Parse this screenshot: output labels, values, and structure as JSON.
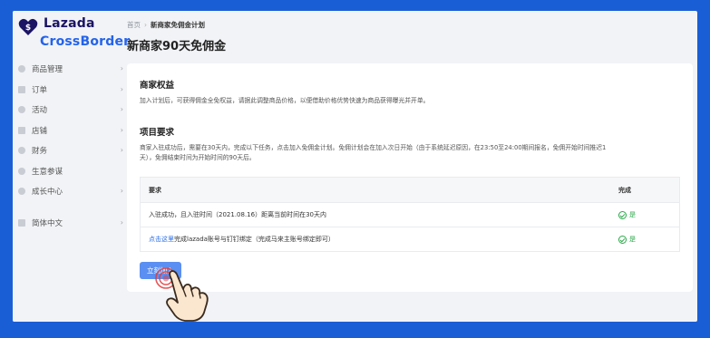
{
  "logo": {
    "line1": "Lazada",
    "line2": "CrossBorder"
  },
  "sidebar": {
    "items": [
      {
        "label": "商品管理",
        "icon": "box-icon"
      },
      {
        "label": "订单",
        "icon": "order-icon"
      },
      {
        "label": "活动",
        "icon": "activity-icon"
      },
      {
        "label": "店铺",
        "icon": "store-icon"
      },
      {
        "label": "财务",
        "icon": "finance-icon"
      },
      {
        "label": "生意参谋",
        "icon": "insight-icon"
      },
      {
        "label": "成长中心",
        "icon": "growth-icon"
      }
    ],
    "language": {
      "label": "简体中文",
      "icon": "language-icon"
    }
  },
  "breadcrumb": {
    "home": "首页",
    "current": "新商家免佣金计划"
  },
  "page_title": "新商家90天免佣金",
  "benefit": {
    "title": "商家权益",
    "text": "加入计划后，可获得佣金全免权益，请据此调整商品价格，以便借助价格优势快速为商品获得曝光并开单。"
  },
  "requirements": {
    "title": "项目要求",
    "text_line1": "商家入驻成功后，需要在30天内，完成以下任务，点击加入免佣金计划。免佣计划会在加入次日开始（由于系统延迟原因，在23:50至24:00期间报名，免佣开始时间推迟1",
    "text_line2": "天），免佣结束时间为开始时间的90天后。",
    "table": {
      "col_requirement": "要求",
      "col_done": "完成",
      "rows": [
        {
          "prefix": "",
          "link": "",
          "text": "入驻成功，且入驻时间（2021.08.16）距离当前时间在30天内",
          "done": "是"
        },
        {
          "prefix": "",
          "link": "点击这里",
          "text": "完成lazada账号与钉钉绑定（完成马来主账号绑定即可）",
          "done": "是"
        }
      ]
    }
  },
  "join_button": "立刻加入",
  "colors": {
    "background": "#1a5ed6",
    "accent": "#5b8ff1",
    "success": "#2ba84a",
    "link": "#2a6ee8"
  }
}
